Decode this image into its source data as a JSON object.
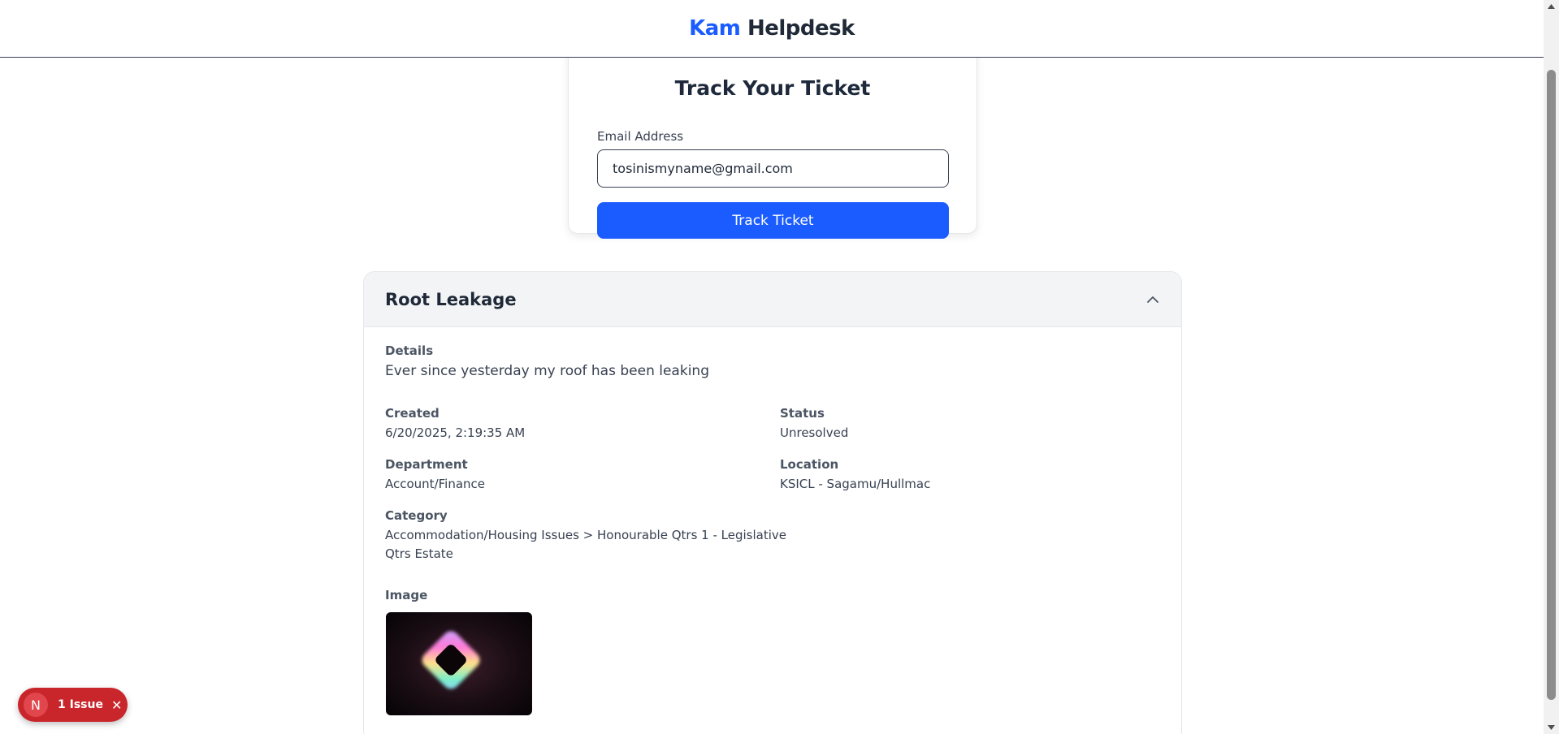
{
  "app": {
    "brand_kam": "Kam",
    "brand_helpdesk": "Helpdesk"
  },
  "track": {
    "title": "Track Your Ticket",
    "email_label": "Email Address",
    "email_value": "tosinismyname@gmail.com",
    "button_label": "Track Ticket"
  },
  "ticket": {
    "title": "Root Leakage",
    "details_label": "Details",
    "details_value": "Ever since yesterday my roof has been leaking",
    "created_label": "Created",
    "created_value": "6/20/2025, 2:19:35 AM",
    "status_label": "Status",
    "status_value": "Unresolved",
    "department_label": "Department",
    "department_value": "Account/Finance",
    "location_label": "Location",
    "location_value": "KSICL - Sagamu/Hullmac",
    "category_label": "Category",
    "category_value_line1": "Accommodation/Housing Issues > Honourable Qtrs 1 - Legislative",
    "category_value_line2": "Qtrs Estate",
    "image_label": "Image"
  },
  "issue_badge": {
    "avatar_letter": "N",
    "text": "1 Issue"
  },
  "colors": {
    "accent": "#1a5cff",
    "badge": "#c9262b"
  },
  "icons": [
    "chevron-up-icon",
    "close-icon",
    "scroll-up-arrow",
    "scroll-down-arrow"
  ]
}
